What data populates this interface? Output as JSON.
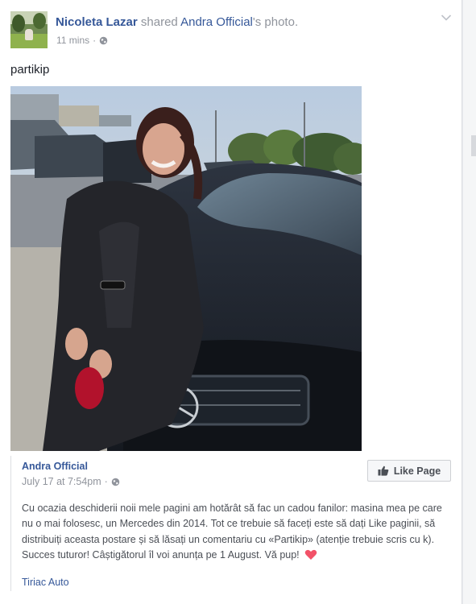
{
  "post": {
    "actor_name": "Nicoleta Lazar",
    "verb": "shared",
    "page_name": "Andra Official",
    "possessive_tail": "'s photo.",
    "time": "11 mins",
    "separator": "·",
    "privacy_icon": "globe-icon",
    "text": "partikip"
  },
  "shared": {
    "page_name": "Andra Official",
    "date": "July 17 at 7:54pm",
    "separator": "·",
    "like_button_label": "Like Page",
    "body": "Cu ocazia deschiderii noii mele pagini am hotărât să fac un cadou fanilor: masina mea pe care nu o mai folosesc, un Mercedes din 2014. Tot ce trebuie să faceți este să dați Like paginii, să distribuiți aceasta postare și să lăsați un comentariu cu «Partikip» (atenție trebuie scris cu k). Succes tuturor! Câștigătorul îl voi anunța pe 1 August. Vă pup!",
    "mention": "Tiriac Auto"
  },
  "colors": {
    "link": "#365899",
    "meta": "#90949c",
    "body": "#4b4f56",
    "heart": "#f25268"
  }
}
